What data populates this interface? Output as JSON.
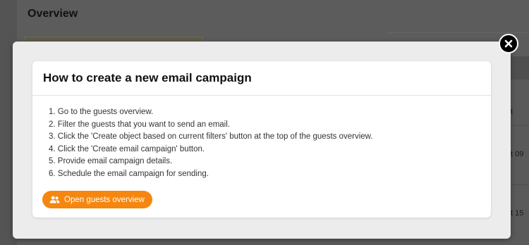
{
  "background": {
    "page_title": "Overview",
    "right_column_header": "t",
    "right_row_1_text": "t 09",
    "right_row_2_text": "t 15"
  },
  "modal": {
    "close_icon": "close-icon",
    "title": "How to create a new email campaign",
    "steps": [
      "1. Go to the guests overview.",
      "2. Filter the guests that you want to send an email.",
      "3. Click the 'Create object based on current filters' button at the top of the guests overview.",
      "4. Click the 'Create email campaign' button.",
      "5. Provide email campaign details.",
      "6. Schedule the email campaign for sending."
    ],
    "primary_button": {
      "label": "Open guests overview",
      "icon": "users-icon"
    }
  },
  "colors": {
    "accent": "#f5860f",
    "overlay": "#5c5c5c"
  }
}
